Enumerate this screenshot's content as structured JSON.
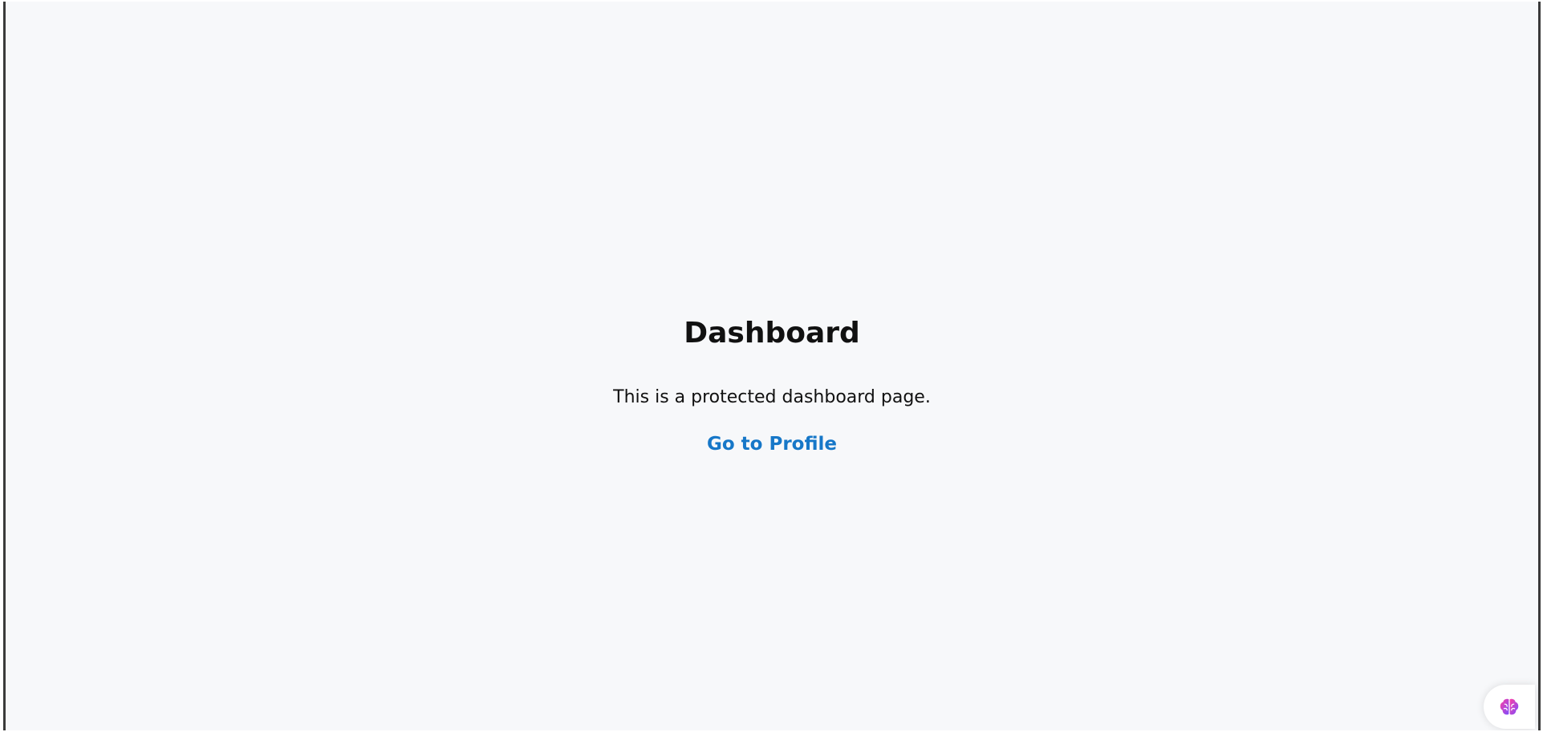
{
  "main": {
    "title": "Dashboard",
    "description": "This is a protected dashboard page.",
    "profile_link": "Go to Profile"
  },
  "icons": {
    "assistant": "brain-icon"
  },
  "colors": {
    "background": "#f7f8fa",
    "link": "#1677c8",
    "text": "#111111",
    "frame_border": "#3a3a3a",
    "icon_gradient_start": "#ff3fa4",
    "icon_gradient_end": "#7b4cff"
  }
}
